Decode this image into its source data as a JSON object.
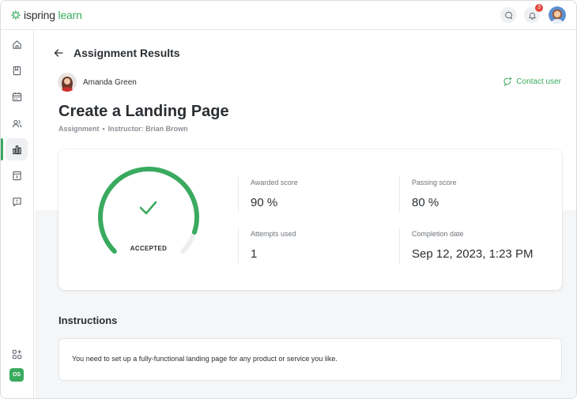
{
  "brand": {
    "name_part1": "ispring",
    "name_part2": " learn",
    "accent": "#3aaa5f"
  },
  "topbar": {
    "notifications_count": "3"
  },
  "sidebar": {
    "items": [
      "home-icon",
      "book-icon",
      "calendar-icon",
      "users-icon",
      "reports-icon",
      "catalog-icon",
      "feedback-icon"
    ],
    "active": "reports-icon",
    "bottom": [
      "add-widget-icon"
    ],
    "org_badge": "OS"
  },
  "page": {
    "title": "Assignment Results"
  },
  "user": {
    "name": "Amanda Green",
    "contact_label": "Contact user"
  },
  "assignment": {
    "title": "Create a Landing Page",
    "type": "Assignment",
    "instructor": "Instructor: Brian Brown"
  },
  "result": {
    "status": "ACCEPTED",
    "score_fraction": 0.9,
    "stats": {
      "awarded_label": "Awarded score",
      "awarded_value": "90 %",
      "passing_label": "Passing score",
      "passing_value": "80 %",
      "attempts_label": "Attempts used",
      "attempts_value": "1",
      "completion_label": "Completion date",
      "completion_value": "Sep 12, 2023, 1:23 PM"
    }
  },
  "instructions": {
    "title": "Instructions",
    "text": "You need to set up a fully-functional landing page for any product or service you like."
  }
}
